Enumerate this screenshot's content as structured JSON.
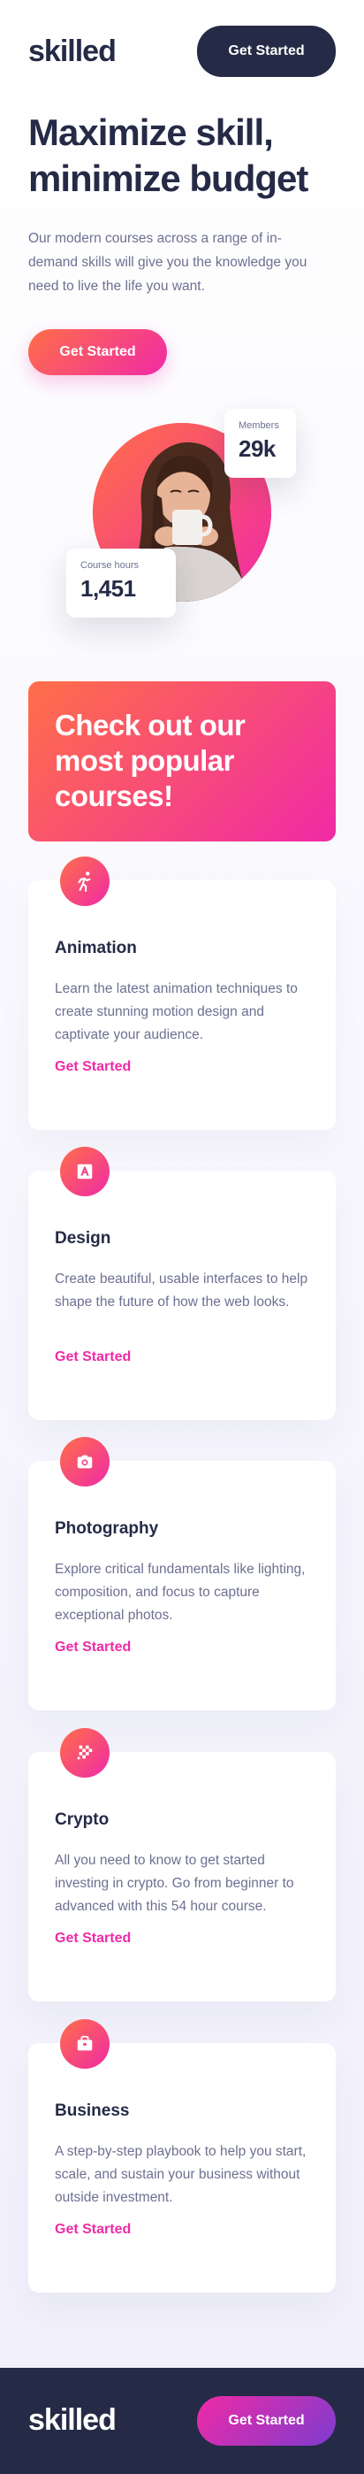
{
  "header": {
    "logo": "skilled",
    "cta_label": "Get Started"
  },
  "hero": {
    "title": "Maximize skill, minimize budget",
    "description": "Our modern courses across a range of in-demand skills will give you the knowledge you need to live the life you want.",
    "cta_label": "Get Started",
    "image_alt": "woman-drinking-from-mug",
    "members": {
      "label": "Members",
      "value": "29k"
    },
    "course_hours": {
      "label": "Course hours",
      "value": "1,451"
    }
  },
  "promo": {
    "title": "Check out our most popular courses!"
  },
  "courses": [
    {
      "icon": "running-figure-icon",
      "title": "Animation",
      "description": "Learn the latest animation techniques to create stunning motion design and captivate your audience.",
      "link": "Get Started"
    },
    {
      "icon": "design-app-icon",
      "title": "Design",
      "description": "Create beautiful, usable interfaces to help shape the future of how the web looks.",
      "link": "Get Started"
    },
    {
      "icon": "camera-icon",
      "title": "Photography",
      "description": "Explore critical fundamentals like lighting, composition, and focus to capture exceptional photos.",
      "link": "Get Started"
    },
    {
      "icon": "crypto-grid-icon",
      "title": "Crypto",
      "description": "All you need to know to get started investing in crypto. Go from beginner to advanced with this 54 hour course.",
      "link": "Get Started"
    },
    {
      "icon": "briefcase-icon",
      "title": "Business",
      "description": "A step-by-step playbook to help you start, scale, and sustain your business without outside investment.",
      "link": "Get Started"
    }
  ],
  "footer": {
    "logo": "skilled",
    "cta_label": "Get Started"
  },
  "colors": {
    "navy": "#252b46",
    "gray_text": "#6d7091",
    "gradient_start": "#ff6f48",
    "gradient_end": "#f02aa6",
    "footer_gradient_end": "#7c3ccf"
  }
}
